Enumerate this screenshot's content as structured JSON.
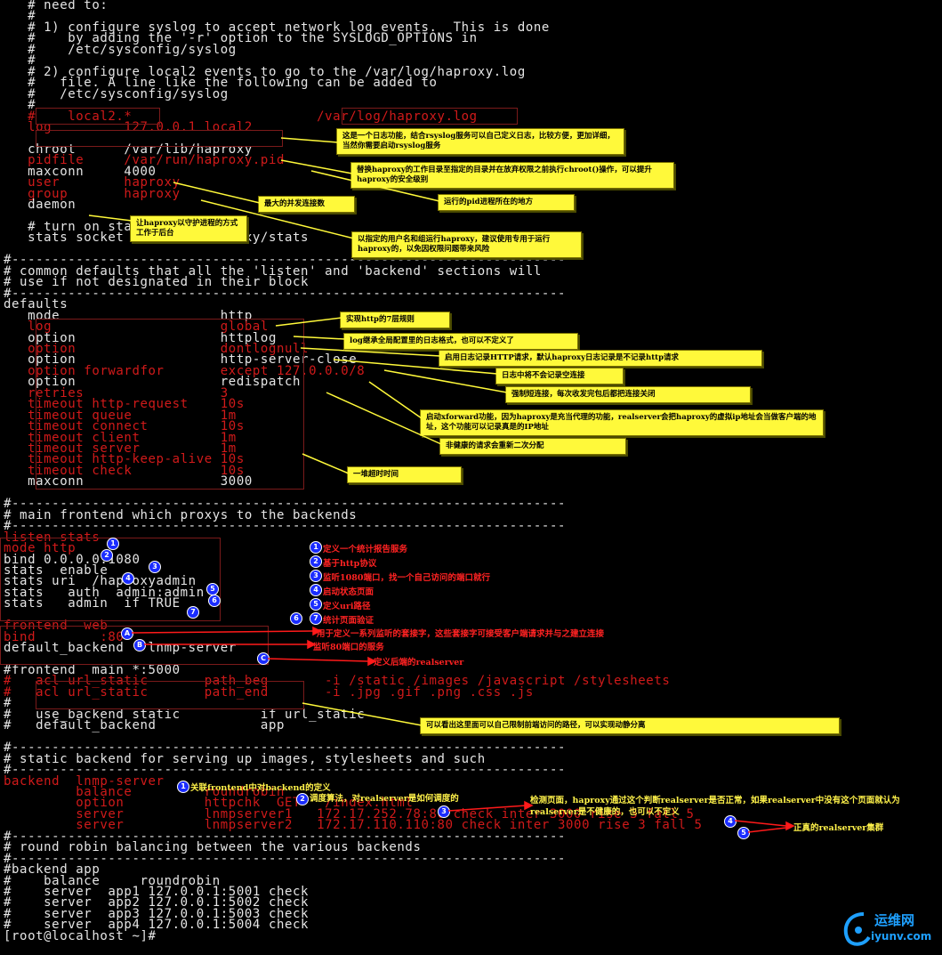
{
  "terminal": {
    "lines": [
      {
        "t": "   # need to:"
      },
      {
        "t": "   #"
      },
      {
        "t": "   # 1) configure syslog to accept network log events.  This is done"
      },
      {
        "t": "   #    by adding the '-r' option to the SYSLOGD_OPTIONS in"
      },
      {
        "t": "   #    /etc/sysconfig/syslog"
      },
      {
        "t": "   #"
      },
      {
        "t": "   # 2) configure local2 events to go to the /var/log/haproxy.log"
      },
      {
        "t": "   #   file. A line like the following can be added to"
      },
      {
        "t": "   #   /etc/sysconfig/syslog"
      },
      {
        "t": "   #"
      },
      {
        "t": "   #    local2.*                       /var/log/haproxy.log",
        "red": true
      },
      {
        "t": "   log         127.0.0.1 local2",
        "red": true
      },
      {
        "t": ""
      },
      {
        "t": "   chroot      /var/lib/haproxy"
      },
      {
        "t": "   pidfile     /var/run/haproxy.pid",
        "red": true
      },
      {
        "t": "   maxconn     4000"
      },
      {
        "t": "   user        haproxy",
        "red": true
      },
      {
        "t": "   group       haproxy",
        "red": true
      },
      {
        "t": "   daemon"
      },
      {
        "t": ""
      },
      {
        "t": "   # turn on stats unix socket"
      },
      {
        "t": "   stats socket /var/lib/haproxy/stats"
      },
      {
        "t": ""
      },
      {
        "t": "#---------------------------------------------------------------------"
      },
      {
        "t": "# common defaults that all the 'listen' and 'backend' sections will"
      },
      {
        "t": "# use if not designated in their block"
      },
      {
        "t": "#---------------------------------------------------------------------"
      },
      {
        "t": "defaults"
      },
      {
        "t": "   mode                    http"
      },
      {
        "t": "   log                     global",
        "red": true
      },
      {
        "t": "   option                  httplog"
      },
      {
        "t": "   option                  dontlognull",
        "red": true
      },
      {
        "t": "   option                  http-server-close"
      },
      {
        "t": "   option forwardfor       except 127.0.0.0/8",
        "red": true
      },
      {
        "t": "   option                  redispatch"
      },
      {
        "t": "   retries                 3",
        "red": true
      },
      {
        "t": "   timeout http-request    10s",
        "red": true
      },
      {
        "t": "   timeout queue           1m",
        "red": true
      },
      {
        "t": "   timeout connect         10s",
        "red": true
      },
      {
        "t": "   timeout client          1m",
        "red": true
      },
      {
        "t": "   timeout server          1m",
        "red": true
      },
      {
        "t": "   timeout http-keep-alive 10s",
        "red": true
      },
      {
        "t": "   timeout check           10s",
        "red": true
      },
      {
        "t": "   maxconn                 3000"
      },
      {
        "t": ""
      },
      {
        "t": "#---------------------------------------------------------------------"
      },
      {
        "t": "# main frontend which proxys to the backends"
      },
      {
        "t": "#---------------------------------------------------------------------"
      },
      {
        "t": "listen stats",
        "red": true
      },
      {
        "t": "mode http",
        "red": true
      },
      {
        "t": "bind 0.0.0.0:1080"
      },
      {
        "t": "stats  enable"
      },
      {
        "t": "stats uri  /haproxyadmin"
      },
      {
        "t": "stats   auth  admin:admin"
      },
      {
        "t": "stats   admin  if TRUE"
      },
      {
        "t": ""
      },
      {
        "t": "frontend  web",
        "red": true
      },
      {
        "t": "bind        :80",
        "red": true
      },
      {
        "t": "default_backend   lnmp-server"
      },
      {
        "t": ""
      },
      {
        "t": "#frontend  main *:5000"
      },
      {
        "t": "#   acl url_static       path_beg       -i /static /images /javascript /stylesheets",
        "red": true
      },
      {
        "t": "#   acl url_static       path_end       -i .jpg .gif .png .css .js",
        "red": true
      },
      {
        "t": "#"
      },
      {
        "t": "#   use_backend static          if url_static"
      },
      {
        "t": "#   default_backend             app"
      },
      {
        "t": ""
      },
      {
        "t": "#---------------------------------------------------------------------"
      },
      {
        "t": "# static backend for serving up images, stylesheets and such"
      },
      {
        "t": "#---------------------------------------------------------------------"
      },
      {
        "t": "backend  lnmp-server",
        "red": true
      },
      {
        "t": "         balance         roundrobin",
        "red": true
      },
      {
        "t": "         option          httpchk  GET   /index.html",
        "red": true
      },
      {
        "t": "         server          lnmpserver1   172.17.252.78:80 check inter 3000 rise 3 fall 5",
        "red": true
      },
      {
        "t": "         server          lnmpserver2   172.17.110.110:80 check inter 3000 rise 3 fall 5",
        "red": true
      },
      {
        "t": "#---------------------------------------------------------------------"
      },
      {
        "t": "# round robin balancing between the various backends"
      },
      {
        "t": "#---------------------------------------------------------------------"
      },
      {
        "t": "#backend app"
      },
      {
        "t": "#    balance     roundrobin"
      },
      {
        "t": "#    server  app1 127.0.0.1:5001 check"
      },
      {
        "t": "#    server  app2 127.0.0.1:5002 check"
      },
      {
        "t": "#    server  app3 127.0.0.1:5003 check"
      },
      {
        "t": "#    server  app4 127.0.0.1:5004 check"
      },
      {
        "t": "[root@localhost ~]#"
      }
    ]
  },
  "notes": {
    "n1": "这是一个日志功能，结合rsyslog服务可以自己定义日志，比较方便，更加详细，当然你需要启动rsyslog服务",
    "n2": "替换haproxy的工作目录至指定的目录并在放弃权限之前执行chroot()操作，可以提升haproxy的安全级别",
    "n3": "运行的pid进程所在的地方",
    "n4": "最大的并发连接数",
    "n5": "让haproxy以守护进程的方式工作于后台",
    "n6": "以指定的用户名和组运行haproxy，建议使用专用于运行haproxy的，以免因权限问题带来风险",
    "n7": "实现http的7层规则",
    "n8": "log继承全局配置里的日志格式，也可以不定义了",
    "n9": "启用日志记录HTTP请求，默认haproxy日志记录是不记录http请求",
    "n10": "日志中将不会记录空连接",
    "n11": "强制短连接，每次收发完包后都把连接关闭",
    "n12": "启动xforward功能，因为haproxy是充当代理的功能，realserver会把haproxy的虚拟ip地址会当做客户端的地址，这个功能可以记录真是的IP地址",
    "n13": "非健康的请求会重新二次分配",
    "n14": "一堆超时时间",
    "n15": "可以看出这里面可以自己限制前端访问的路径，可以实现动静分离"
  },
  "stats_notes": [
    {
      "num": "1",
      "text": "定义一个统计报告服务"
    },
    {
      "num": "2",
      "text": "基于http协议"
    },
    {
      "num": "3",
      "text": "监听1080端口，找一个自己访问的端口就行"
    },
    {
      "num": "4",
      "text": "启动状态页面"
    },
    {
      "num": "5",
      "text": "定义uri路径"
    },
    {
      "num": "6",
      "text": ""
    },
    {
      "num": "7",
      "text": "统计页面验证"
    }
  ],
  "stats_badges": [
    "1",
    "2",
    "3",
    "4",
    "5",
    "6",
    "7"
  ],
  "frontend_notes": {
    "a": "用于定义一系列监听的套接字，这些套接字可接受客户端请求并与之建立连接",
    "b": "监听80端口的服务",
    "c": "定义后端的realserver",
    "badge_a": "A",
    "badge_b": "B",
    "badge_c": "C"
  },
  "backend_notes": {
    "n1": "关联frontend中对backend的定义",
    "n2": "调度算法，对realserver是如何调度的",
    "n3": "检测页面，haproxy通过这个判断realserver是否正常，如果realserver中没有这个页面就认为realserver是不健康的，也可以不定义",
    "n5": "正真的realserver集群",
    "b1": "1",
    "b2": "2",
    "b3": "3",
    "b4": "4",
    "b5": "5"
  },
  "watermark": {
    "line1": "运维网",
    "line2": "iyunv.com"
  }
}
